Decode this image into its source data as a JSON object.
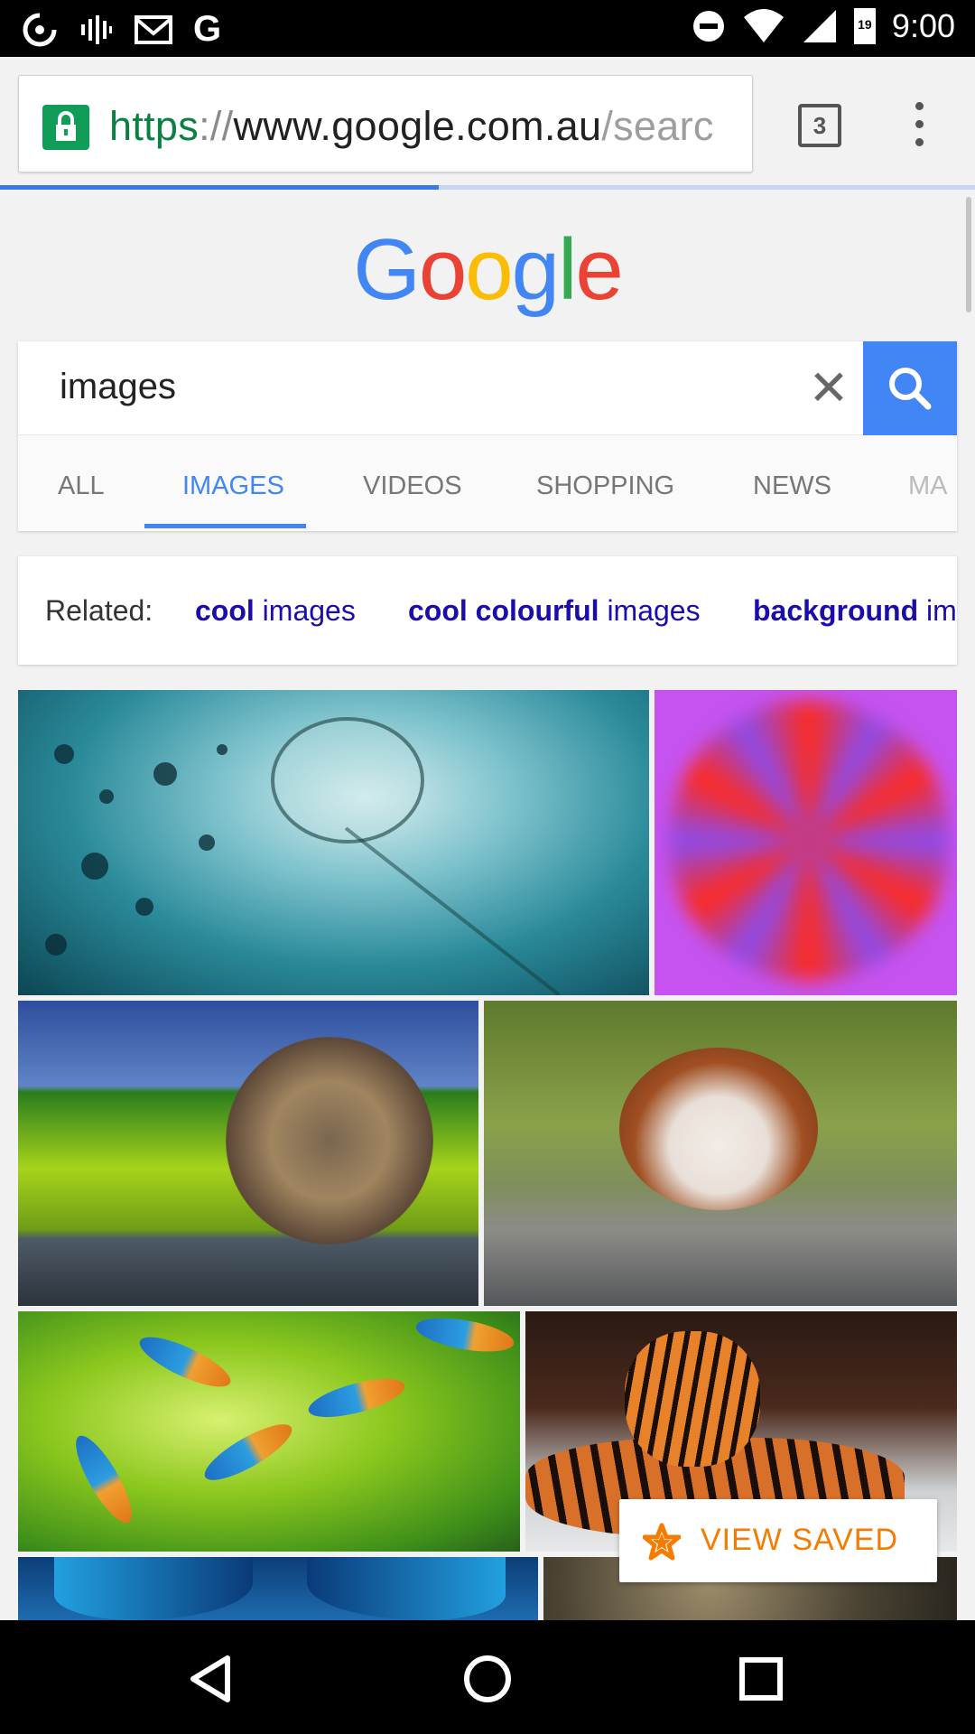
{
  "status_bar": {
    "time": "9:00",
    "left_icons": [
      "sync-icon",
      "voicemail-icon",
      "gmail-icon",
      "google-icon"
    ],
    "right_icons": [
      "do-not-disturb-icon",
      "wifi-icon",
      "signal-icon",
      "battery-icon"
    ],
    "battery_level": "19",
    "google_letter": "G"
  },
  "browser": {
    "url_scheme": "https",
    "url_separator": "://",
    "url_host": "www.google.com.au",
    "url_path": "/searc",
    "tab_count": "3",
    "load_progress": 0.45,
    "secure_color": "#0f9d58"
  },
  "google": {
    "logo_letters": [
      "G",
      "o",
      "o",
      "g",
      "l",
      "e"
    ],
    "search_query": "images",
    "tabs": [
      {
        "label": "ALL",
        "active": false
      },
      {
        "label": "IMAGES",
        "active": true
      },
      {
        "label": "VIDEOS",
        "active": false
      },
      {
        "label": "SHOPPING",
        "active": false
      },
      {
        "label": "NEWS",
        "active": false
      },
      {
        "label": "MA",
        "active": false
      }
    ],
    "accent_color": "#4285f4"
  },
  "related": {
    "label": "Related:",
    "items": [
      {
        "bold": "cool",
        "rest": " images"
      },
      {
        "bold": "cool colourful",
        "rest": " images"
      },
      {
        "bold": "background",
        "rest": " im"
      }
    ]
  },
  "images": [
    {
      "name": "jellyfish",
      "desc_icon": "image-thumbnail"
    },
    {
      "name": "red-purple-swirl",
      "desc_icon": "image-thumbnail"
    },
    {
      "name": "bicycle-baskets",
      "desc_icon": "image-thumbnail"
    },
    {
      "name": "hamster",
      "desc_icon": "image-thumbnail"
    },
    {
      "name": "kingfishers",
      "desc_icon": "image-thumbnail"
    },
    {
      "name": "tiger",
      "desc_icon": "image-thumbnail"
    },
    {
      "name": "butterfly-wings",
      "desc_icon": "image-thumbnail"
    },
    {
      "name": "bubbles",
      "desc_icon": "image-thumbnail"
    }
  ],
  "view_saved": {
    "label": "VIEW SAVED",
    "icon": "star-icon",
    "color": "#f57c00"
  },
  "nav_bar": {
    "buttons": [
      "back-icon",
      "home-icon",
      "recents-icon"
    ]
  }
}
